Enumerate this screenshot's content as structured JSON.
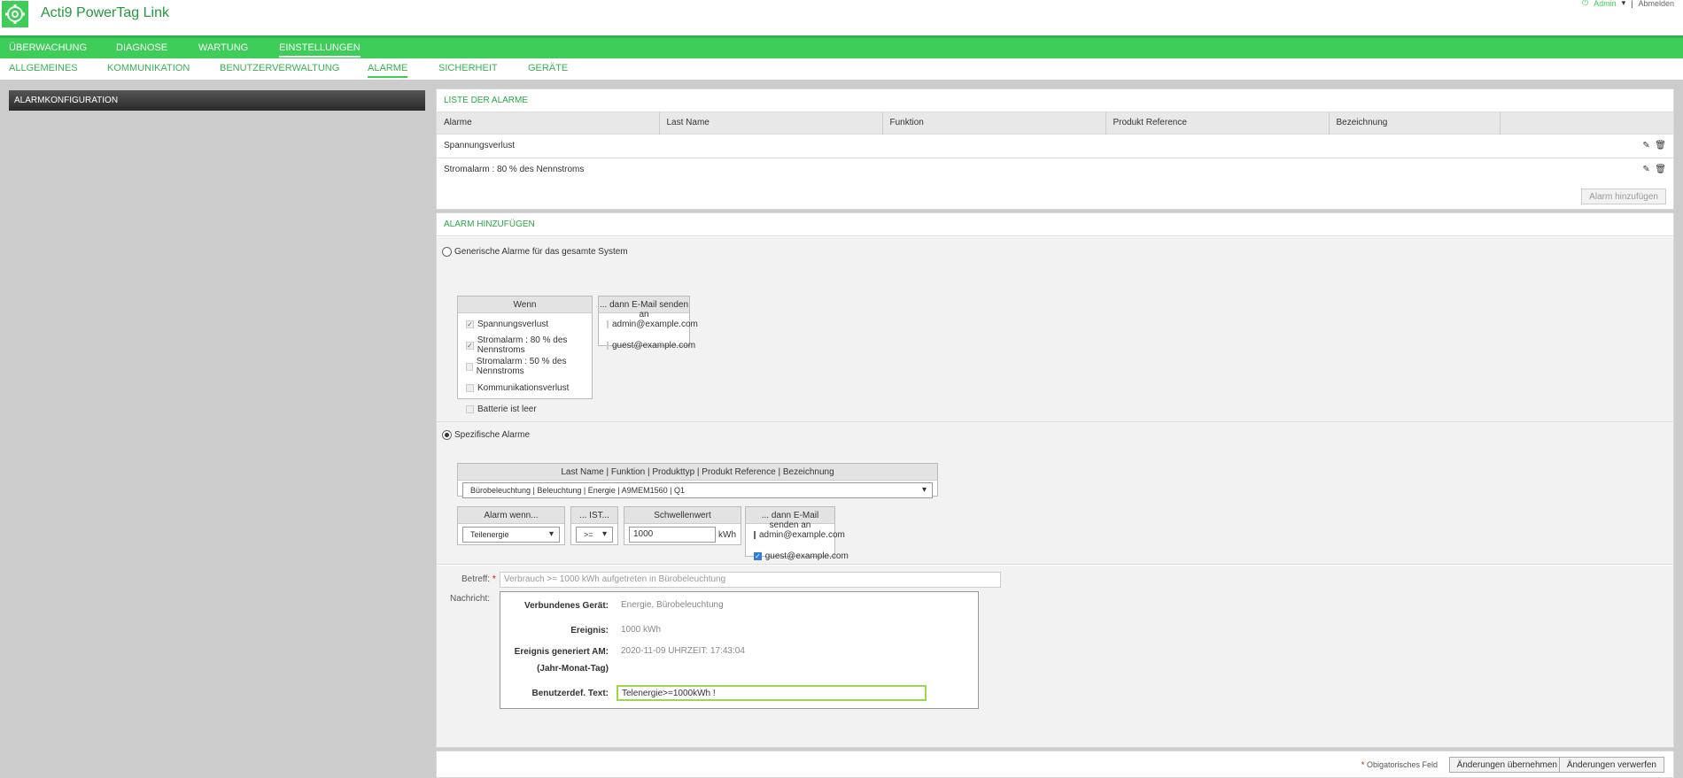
{
  "app": {
    "title": "Acti9 PowerTag Link",
    "user": "Admin",
    "logout": "Abmelden"
  },
  "nav_main": [
    {
      "label": "ÜBERWACHUNG",
      "active": false
    },
    {
      "label": "DIAGNOSE",
      "active": false
    },
    {
      "label": "WARTUNG",
      "active": false
    },
    {
      "label": "EINSTELLUNGEN",
      "active": true
    }
  ],
  "nav_sub": [
    {
      "label": "ALLGEMEINES"
    },
    {
      "label": "KOMMUNIKATION"
    },
    {
      "label": "BENUTZERVERWALTUNG"
    },
    {
      "label": "ALARME",
      "active": true
    },
    {
      "label": "SICHERHEIT"
    },
    {
      "label": "GERÄTE"
    }
  ],
  "sidebar": {
    "title": "ALARMKONFIGURATION"
  },
  "alarm_list": {
    "title": "LISTE DER ALARME",
    "columns": [
      "Alarme",
      "Last Name",
      "Funktion",
      "Produkt Reference",
      "Bezeichnung"
    ],
    "rows": [
      {
        "alarm": "Spannungsverlust"
      },
      {
        "alarm": "Stromalarm : 80 % des Nennstroms"
      }
    ],
    "add_button": "Alarm hinzufügen"
  },
  "add_alarm": {
    "title": "ALARM HINZUFÜGEN",
    "generic_label": "Generische Alarme für das gesamte System",
    "when_header": "Wenn",
    "when_items": [
      "Spannungsverlust",
      "Stromalarm : 80 % des Nennstroms",
      "Stromalarm : 50 % des Nennstroms",
      "Kommunikationsverlust",
      "Batterie ist leer"
    ],
    "email_header": "... dann E-Mail senden an",
    "emails": [
      "admin@example.com",
      "guest@example.com"
    ],
    "specific_label": "Spezifische Alarme",
    "device_header": "Last Name | Funktion | Produkttyp | Produkt Reference | Bezeichnung",
    "device_value": "Bürobeleuchtung | Beleuchtung | Energie | A9MEM1560 | Q1",
    "alarm_when_header": "Alarm wenn...",
    "alarm_when_value": "Teilenergie",
    "is_header": "... IST...",
    "is_value": ">=",
    "threshold_header": "Schwellenwert",
    "threshold_value": "1000",
    "threshold_unit": "kWh",
    "specific_email_header": "... dann E-Mail senden an",
    "specific_emails": [
      "admin@example.com",
      "guest@example.com"
    ],
    "subject_label": "Betreff:",
    "subject_star": "*",
    "subject_value": "Verbrauch >= 1000 kWh aufgetreten in Bürobeleuchtung",
    "message_label": "Nachricht:",
    "msg_device_label": "Verbundenes Gerät:",
    "msg_device_value": "Energie, Bürobeleuchtung",
    "msg_event_label": "Ereignis:",
    "msg_event_value": "1000 kWh",
    "msg_generated_label": "Ereignis generiert AM:",
    "msg_generated_sub": "(Jahr-Monat-Tag)",
    "msg_generated_value": "2020-11-09 UHRZEIT: 17:43:04",
    "msg_custom_label": "Benutzerdef. Text:",
    "msg_custom_value": "Telenergie>=1000kWh !"
  },
  "footer": {
    "mandatory": "Obigatorisches Feld",
    "star": "*",
    "apply": "Änderungen übernehmen",
    "discard": "Änderungen verwerfen"
  }
}
